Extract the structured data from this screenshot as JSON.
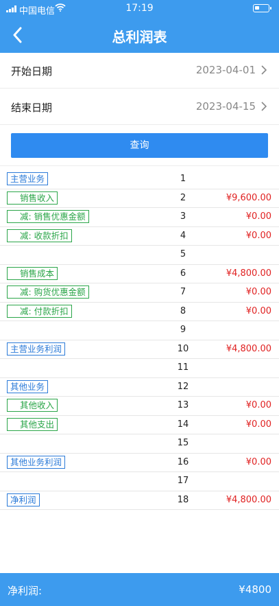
{
  "status_bar": {
    "carrier": "中国电信",
    "time": "17:19"
  },
  "nav": {
    "title": "总利润表"
  },
  "filters": [
    {
      "label": "开始日期",
      "value": "2023-04-01"
    },
    {
      "label": "结束日期",
      "value": "2023-04-15"
    }
  ],
  "query_button": "查询",
  "rows": [
    {
      "tag": "主营业务",
      "color": "blue",
      "indent": false,
      "num": "1",
      "amount": ""
    },
    {
      "tag": "销售收入",
      "color": "green",
      "indent": true,
      "num": "2",
      "amount": "¥9,600.00"
    },
    {
      "tag": "减: 销售优惠金额",
      "color": "green",
      "indent": true,
      "num": "3",
      "amount": "¥0.00"
    },
    {
      "tag": "减: 收款折扣",
      "color": "green",
      "indent": true,
      "num": "4",
      "amount": "¥0.00"
    },
    {
      "tag": "",
      "color": "",
      "indent": false,
      "num": "5",
      "amount": ""
    },
    {
      "tag": "销售成本",
      "color": "green",
      "indent": true,
      "num": "6",
      "amount": "¥4,800.00"
    },
    {
      "tag": "减: 购货优惠金额",
      "color": "green",
      "indent": true,
      "num": "7",
      "amount": "¥0.00"
    },
    {
      "tag": "减: 付款折扣",
      "color": "green",
      "indent": true,
      "num": "8",
      "amount": "¥0.00"
    },
    {
      "tag": "",
      "color": "",
      "indent": false,
      "num": "9",
      "amount": ""
    },
    {
      "tag": "主营业务利润",
      "color": "blue",
      "indent": false,
      "num": "10",
      "amount": "¥4,800.00"
    },
    {
      "tag": "",
      "color": "",
      "indent": false,
      "num": "11",
      "amount": ""
    },
    {
      "tag": "其他业务",
      "color": "blue",
      "indent": false,
      "num": "12",
      "amount": ""
    },
    {
      "tag": "其他收入",
      "color": "green",
      "indent": true,
      "num": "13",
      "amount": "¥0.00"
    },
    {
      "tag": "其他支出",
      "color": "green",
      "indent": true,
      "num": "14",
      "amount": "¥0.00"
    },
    {
      "tag": "",
      "color": "",
      "indent": false,
      "num": "15",
      "amount": ""
    },
    {
      "tag": "其他业务利润",
      "color": "blue",
      "indent": false,
      "num": "16",
      "amount": "¥0.00"
    },
    {
      "tag": "",
      "color": "",
      "indent": false,
      "num": "17",
      "amount": ""
    },
    {
      "tag": "净利润",
      "color": "blue",
      "indent": false,
      "num": "18",
      "amount": "¥4,800.00"
    }
  ],
  "footer": {
    "label": "净利润:",
    "value": "¥4800"
  },
  "colors": {
    "primary": "#3d9bee",
    "button": "#2f8bf0",
    "tag_blue": "#2a7ad8",
    "tag_green": "#2aa548",
    "amount_red": "#e02020"
  },
  "icons": {
    "back": "chevron-left-icon",
    "row_arrow": "chevron-right-icon",
    "wifi": "wifi-icon",
    "battery": "battery-icon",
    "signal": "signal-icon"
  }
}
